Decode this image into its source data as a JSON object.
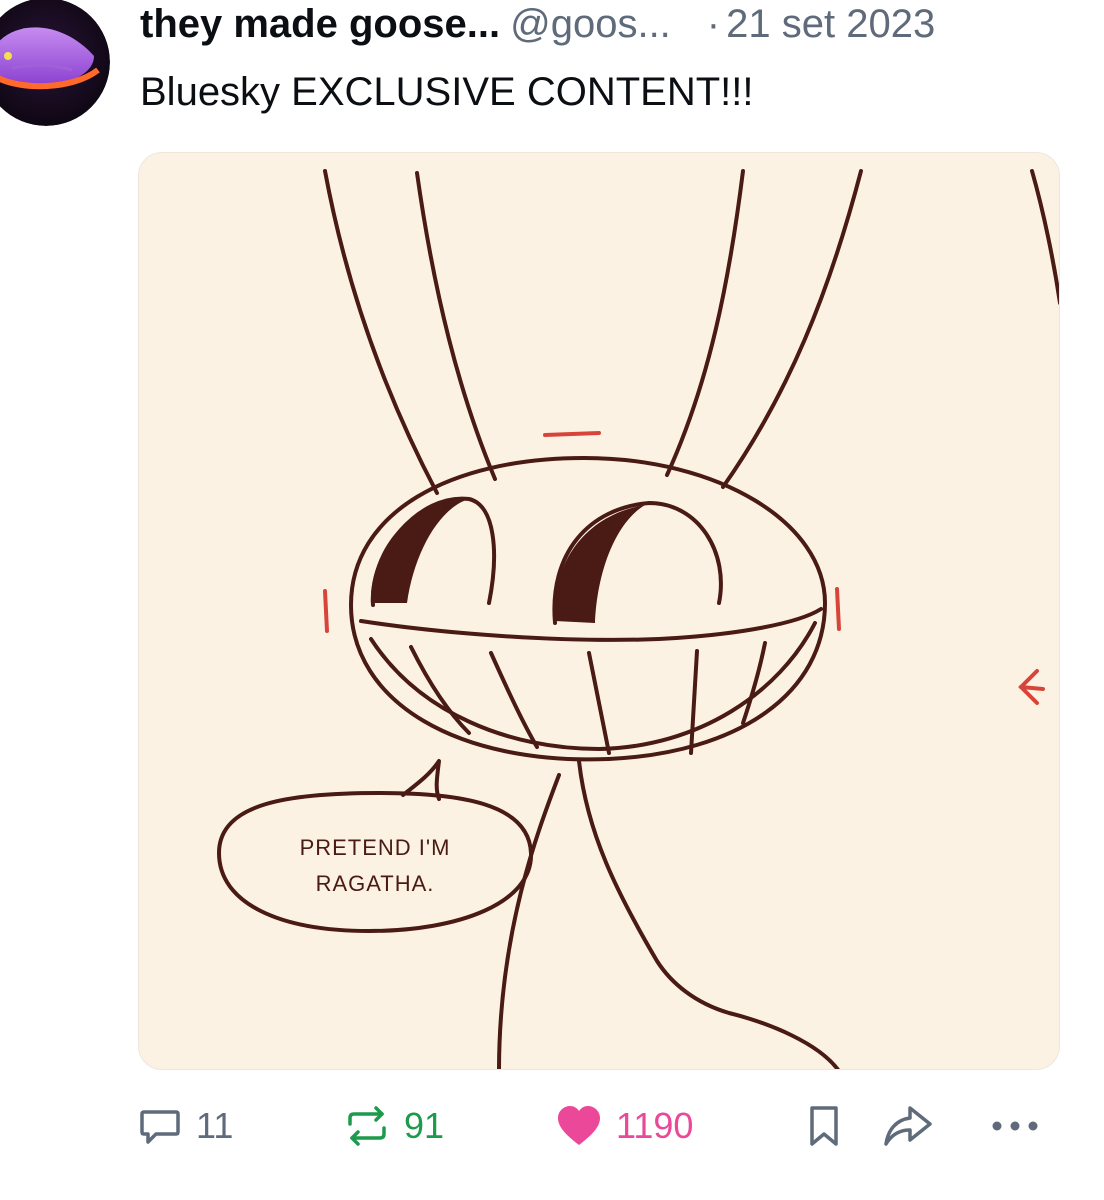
{
  "post": {
    "display_name": "they made goose...",
    "handle": "@goos...",
    "dot": "·",
    "date": "21 set 2023",
    "text": "Bluesky EXCLUSIVE CONTENT!!!"
  },
  "image": {
    "speech_line1": "PRETEND I'M",
    "speech_line2": "RAGATHA."
  },
  "actions": {
    "reply_count": "11",
    "repost_count": "91",
    "like_count": "1190",
    "icons": [
      "reply-icon",
      "repost-icon",
      "heart-icon",
      "bookmark-icon",
      "share-icon",
      "more-icon"
    ]
  },
  "colors": {
    "meta_gray": "#5f6b7a",
    "repost_green": "#1d9a4c",
    "like_pink": "#ec4899",
    "image_bg": "#fcf2e3",
    "ink": "#4a1a14"
  }
}
